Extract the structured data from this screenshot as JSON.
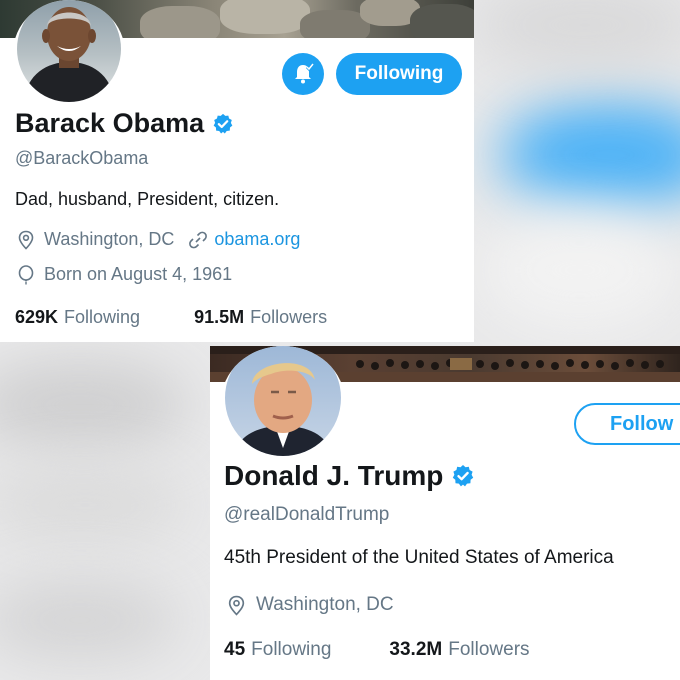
{
  "colors": {
    "accent": "#1da1f2",
    "link": "#1b95e0",
    "text": "#14171a",
    "muted": "#657786"
  },
  "profile_1": {
    "name": "Barack Obama",
    "handle": "@BarackObama",
    "bio": "Dad, husband, President, citizen.",
    "location": "Washington, DC",
    "website": "obama.org",
    "birthday": "Born on August 4, 1961",
    "following_count": "629K",
    "following_label": "Following",
    "followers_count": "91.5M",
    "followers_label": "Followers",
    "follow_state_button": "Following",
    "icons": [
      "verified-badge-icon",
      "notification-bell-icon",
      "location-pin-icon",
      "link-icon",
      "balloon-icon"
    ]
  },
  "profile_2": {
    "name": "Donald J. Trump",
    "handle": "@realDonaldTrump",
    "bio": "45th President of the United States of America",
    "location": "Washington, DC",
    "following_count": "45",
    "following_label": "Following",
    "followers_count": "33.2M",
    "followers_label": "Followers",
    "follow_button": "Follow",
    "icons": [
      "verified-badge-icon",
      "location-pin-icon"
    ]
  }
}
